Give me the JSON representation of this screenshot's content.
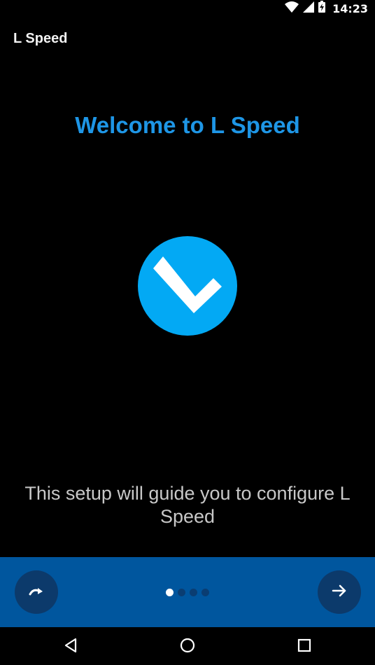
{
  "status_bar": {
    "time": "14:23",
    "icons": [
      "wifi-icon",
      "cell-signal-icon",
      "battery-charging-icon"
    ]
  },
  "app": {
    "title": "L Speed"
  },
  "welcome": {
    "heading": "Welcome to L Speed",
    "logo_letter": "L",
    "description": "This setup will guide you to configure L Speed"
  },
  "pager": {
    "total_pages": 4,
    "current_page": 1,
    "skip_icon": "redo-icon",
    "next_icon": "arrow-right-icon"
  },
  "navigation_bar": {
    "icons": [
      "back-icon",
      "home-icon",
      "recents-icon"
    ]
  },
  "colors": {
    "accent": "#1e96e6",
    "logo_circle": "#03a9f4",
    "bottom_bar": "#00569e",
    "button": "#0c3a6b"
  }
}
